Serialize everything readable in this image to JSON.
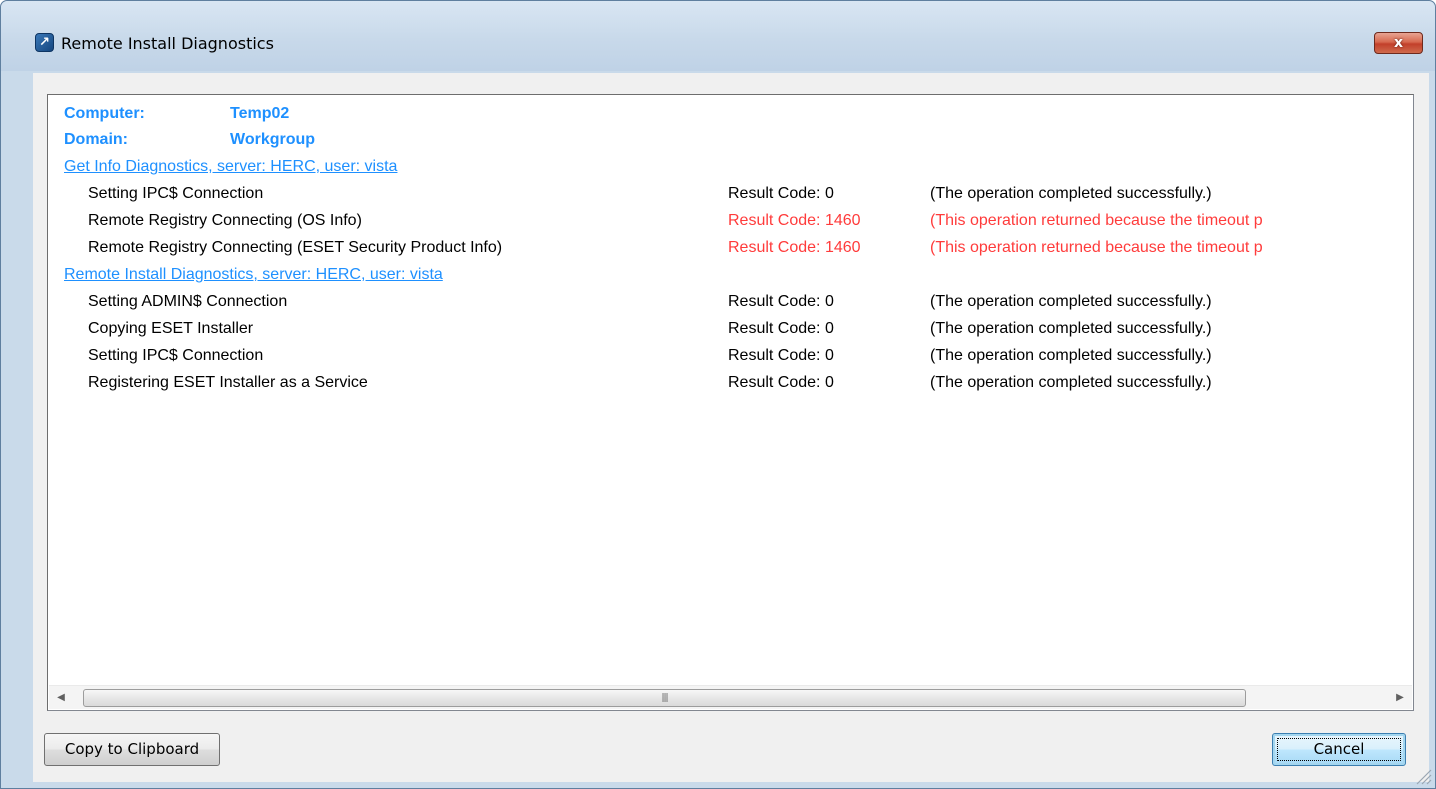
{
  "window": {
    "title": "Remote Install Diagnostics",
    "close_label": "x"
  },
  "header": {
    "computer_label": "Computer:",
    "computer_value": "Temp02",
    "domain_label": "Domain:",
    "domain_value": "Workgroup"
  },
  "sections": [
    {
      "title": "Get Info Diagnostics, server: HERC, user: vista",
      "rows": [
        {
          "task": "Setting IPC$ Connection",
          "code": "Result Code: 0",
          "message": "(The operation completed successfully.)",
          "status": "ok"
        },
        {
          "task": "Remote Registry Connecting (OS Info)",
          "code": "Result Code: 1460",
          "message": "(This operation returned because the timeout p",
          "status": "error"
        },
        {
          "task": "Remote Registry Connecting (ESET Security Product Info)",
          "code": "Result Code: 1460",
          "message": "(This operation returned because the timeout p",
          "status": "error"
        }
      ]
    },
    {
      "title": "Remote Install Diagnostics, server: HERC, user: vista",
      "rows": [
        {
          "task": "Setting ADMIN$ Connection",
          "code": "Result Code: 0",
          "message": "(The operation completed successfully.)",
          "status": "ok"
        },
        {
          "task": "Copying ESET Installer",
          "code": "Result Code: 0",
          "message": "(The operation completed successfully.)",
          "status": "ok"
        },
        {
          "task": "Setting IPC$ Connection",
          "code": "Result Code: 0",
          "message": "(The operation completed successfully.)",
          "status": "ok"
        },
        {
          "task": "Registering ESET Installer as a Service",
          "code": "Result Code: 0",
          "message": "(The operation completed successfully.)",
          "status": "ok"
        }
      ]
    }
  ],
  "buttons": {
    "copy_label": "Copy to Clipboard",
    "cancel_label": "Cancel"
  },
  "icons": {
    "app": "eset-arrow-icon",
    "close": "close-icon",
    "scroll_left": "scroll-left-icon",
    "scroll_right": "scroll-right-icon",
    "grip": "scrollbar-grip-icon"
  },
  "colors": {
    "link": "#1e90ff",
    "error": "#ff3b3b",
    "close_button": "#c2402a"
  }
}
